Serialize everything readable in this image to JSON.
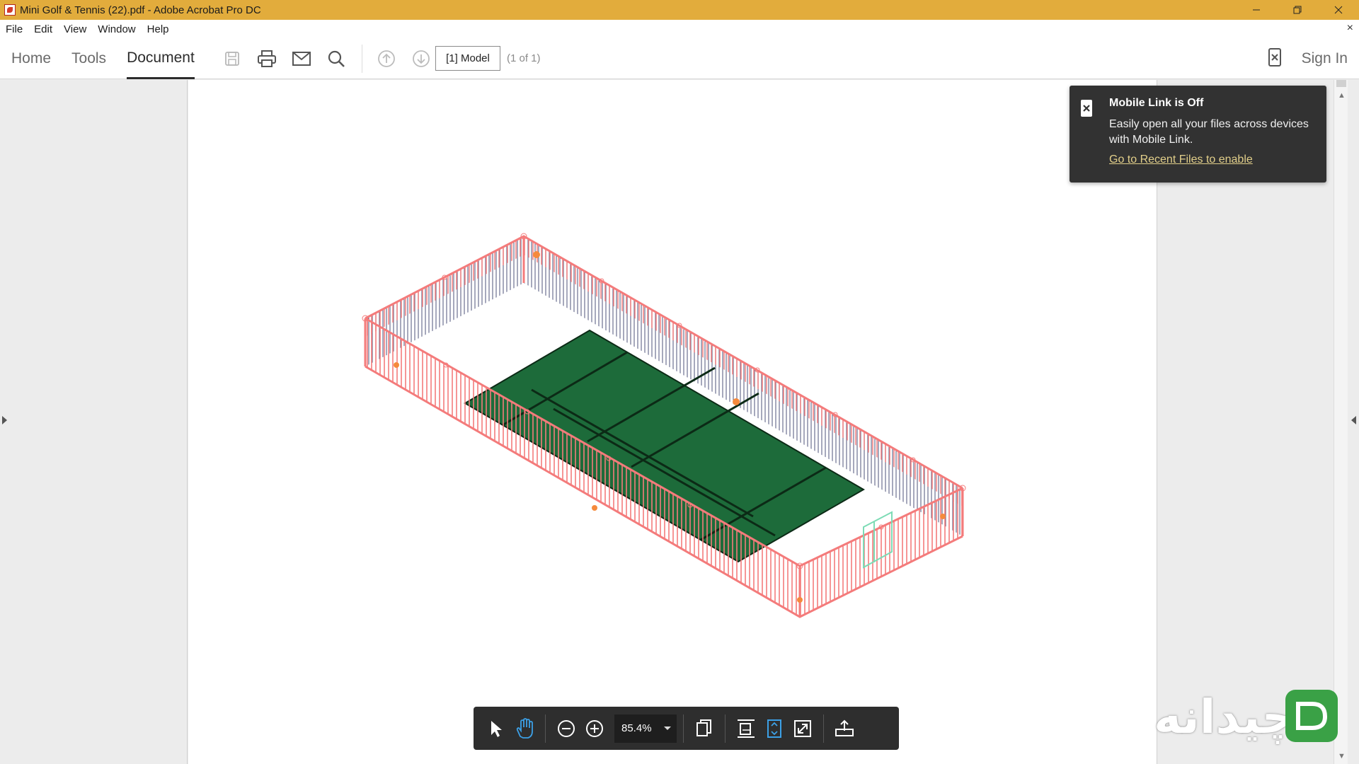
{
  "window": {
    "title": "Mini Golf & Tennis (22).pdf - Adobe Acrobat Pro DC"
  },
  "menu": {
    "items": [
      "File",
      "Edit",
      "View",
      "Window",
      "Help"
    ],
    "close_symbol": "×"
  },
  "toolbar": {
    "tabs": [
      {
        "label": "Home",
        "active": false
      },
      {
        "label": "Tools",
        "active": false
      },
      {
        "label": "Document",
        "active": true
      }
    ],
    "icons": [
      "save-icon",
      "print-icon",
      "email-icon",
      "search-icon",
      "page-up-icon",
      "page-down-icon"
    ],
    "page_label": "[1] Model",
    "page_count": "(1 of 1)",
    "sign_in": "Sign In"
  },
  "toast": {
    "title": "Mobile Link is Off",
    "body": "Easily open all your files across devices with Mobile Link.",
    "link": "Go to Recent Files to enable"
  },
  "bottom_toolbar": {
    "zoom": "85.4%",
    "icons": [
      "select-arrow-icon",
      "hand-icon",
      "zoom-out-icon",
      "zoom-in-icon",
      "page-mode-icon",
      "fit-width-icon",
      "fit-page-icon",
      "fullscreen-icon",
      "share-icon"
    ]
  },
  "watermark": {
    "text": "چیدانه"
  },
  "colors": {
    "titlebar": "#e2ac3c",
    "court": "#1d6b3a",
    "fence": "#f47b7b",
    "netting": "#3a3f6b",
    "toast_bg": "#323232",
    "toast_link": "#e2cf8a",
    "floating_bar": "#2e2e2e",
    "active_hand": "#3ca0e6",
    "watermark_green": "#3aa146"
  }
}
